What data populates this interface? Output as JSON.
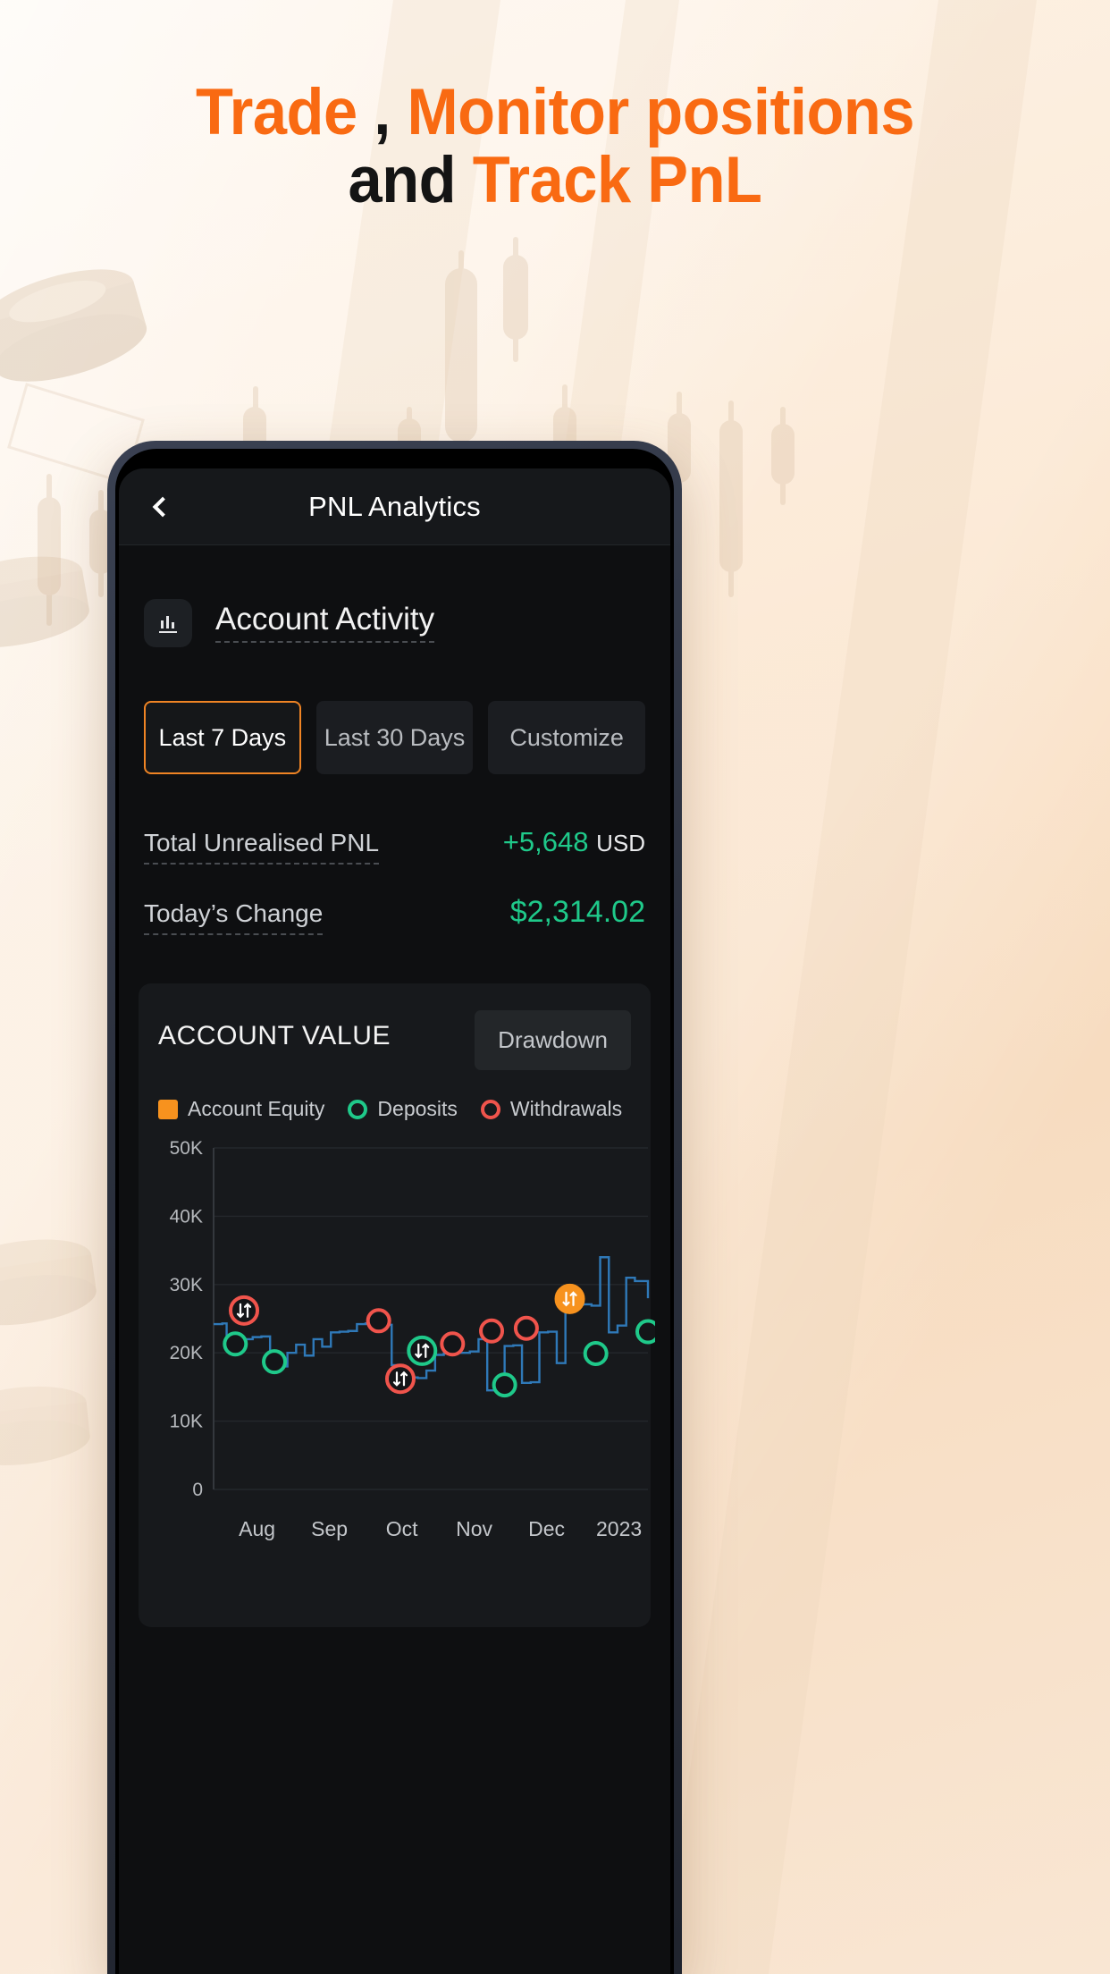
{
  "headline": {
    "line1_part1": "Trade ",
    "line1_comma": ",",
    "line1_part2": " Monitor positions",
    "line2_part1": "and ",
    "line2_part2": "Track PnL",
    "accent_color": "#f96a12",
    "dark_color": "#141414"
  },
  "app": {
    "header": {
      "back_icon": "chevron-left-icon",
      "title": "PNL Analytics"
    },
    "section": {
      "icon": "bar-chart-icon",
      "title": "Account Activity"
    },
    "chips": [
      {
        "label": "Last 7 Days",
        "selected": true
      },
      {
        "label": "Last 30 Days",
        "selected": false
      },
      {
        "label": "Customize",
        "selected": false
      }
    ],
    "stats": [
      {
        "label": "Total Unrealised PNL",
        "value": "+5,648",
        "unit": "USD",
        "value_color": "#1fc98a"
      },
      {
        "label": "Today’s Change",
        "value": "$2,314.02",
        "unit": "",
        "value_color": "#1fc98a"
      }
    ],
    "chart_card": {
      "title": "ACCOUNT VALUE",
      "drawdown_label": "Drawdown",
      "legend": [
        {
          "label": "Account Equity",
          "color": "#f7921e",
          "shape": "square"
        },
        {
          "label": "Deposits",
          "color": "#1fc98a",
          "shape": "ring"
        },
        {
          "label": "Withdrawals",
          "color": "#f0544c",
          "shape": "ring"
        }
      ]
    }
  },
  "chart_data": {
    "type": "line",
    "title": "ACCOUNT VALUE",
    "xlabel": "",
    "ylabel": "",
    "ylim": [
      0,
      50000
    ],
    "yticks": [
      50000,
      40000,
      30000,
      20000,
      10000,
      0
    ],
    "ytick_labels": [
      "50K",
      "40K",
      "30K",
      "20K",
      "10K",
      "0"
    ],
    "xtick_labels": [
      "Aug",
      "Sep",
      "Oct",
      "Nov",
      "Dec",
      "2023"
    ],
    "grid": true,
    "legend_position": "top-left",
    "series": [
      {
        "name": "Account Equity",
        "color": "#2f79b8",
        "type": "step-line",
        "x": [
          0,
          2,
          3,
          5,
          7,
          9,
          11,
          13,
          15,
          17,
          19,
          21,
          23,
          25,
          27,
          29,
          31,
          33,
          35,
          37,
          39,
          41,
          43,
          45,
          47,
          49,
          51,
          53,
          55,
          57,
          59,
          61,
          63,
          65,
          67,
          69,
          71,
          73,
          75,
          77,
          79,
          81,
          83,
          85,
          87,
          89,
          91,
          93,
          95,
          97,
          100
        ],
        "values": [
          24200,
          24300,
          21800,
          22200,
          22000,
          22300,
          22400,
          17800,
          18000,
          20000,
          21200,
          19600,
          22000,
          20900,
          23000,
          23100,
          23200,
          24200,
          24300,
          24300,
          24100,
          18200,
          16400,
          16400,
          16300,
          17400,
          19700,
          19900,
          20000,
          20000,
          20200,
          22000,
          14500,
          14600,
          21000,
          21100,
          15600,
          15700,
          23000,
          23100,
          18500,
          26500,
          27000,
          27100,
          26900,
          34000,
          23000,
          24000,
          31000,
          30500,
          28000
        ]
      }
    ],
    "markers": [
      {
        "type": "withdrawal",
        "label": "withdrawal-transfer",
        "color": "#f0544c",
        "x": 7,
        "y": 26200,
        "has_arrow_glyph": true
      },
      {
        "type": "deposit",
        "label": "deposit",
        "color": "#1fc98a",
        "x": 5,
        "y": 21300,
        "has_arrow_glyph": false
      },
      {
        "type": "deposit",
        "label": "deposit",
        "color": "#1fc98a",
        "x": 14,
        "y": 18700,
        "has_arrow_glyph": false
      },
      {
        "type": "withdrawal",
        "label": "withdrawal",
        "color": "#f0544c",
        "x": 38,
        "y": 24700,
        "has_arrow_glyph": false
      },
      {
        "type": "withdrawal",
        "label": "withdrawal-transfer",
        "color": "#f0544c",
        "x": 43,
        "y": 16200,
        "has_arrow_glyph": true
      },
      {
        "type": "deposit",
        "label": "deposit-transfer",
        "color": "#1fc98a",
        "x": 48,
        "y": 20300,
        "has_arrow_glyph": true
      },
      {
        "type": "withdrawal",
        "label": "withdrawal",
        "color": "#f0544c",
        "x": 55,
        "y": 21300,
        "has_arrow_glyph": false
      },
      {
        "type": "withdrawal",
        "label": "withdrawal",
        "color": "#f0544c",
        "x": 64,
        "y": 23200,
        "has_arrow_glyph": false
      },
      {
        "type": "deposit",
        "label": "deposit",
        "color": "#1fc98a",
        "x": 67,
        "y": 15300,
        "has_arrow_glyph": false
      },
      {
        "type": "withdrawal",
        "label": "withdrawal",
        "color": "#f0544c",
        "x": 72,
        "y": 23600,
        "has_arrow_glyph": false
      },
      {
        "type": "equity",
        "label": "account-equity-event",
        "color": "#f7921e",
        "x": 82,
        "y": 27900,
        "has_arrow_glyph": true
      },
      {
        "type": "deposit",
        "label": "deposit",
        "color": "#1fc98a",
        "x": 88,
        "y": 19900,
        "has_arrow_glyph": false
      },
      {
        "type": "deposit",
        "label": "deposit",
        "color": "#1fc98a",
        "x": 100,
        "y": 23100,
        "has_arrow_glyph": false
      }
    ]
  }
}
